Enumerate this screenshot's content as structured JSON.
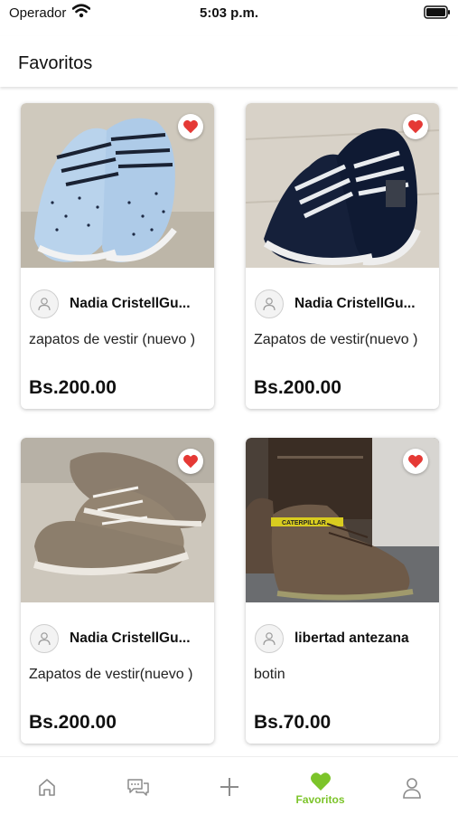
{
  "status_bar": {
    "carrier": "Operador",
    "time": "5:03 p.m."
  },
  "header": {
    "title": "Favoritos"
  },
  "products": [
    {
      "seller": "Nadia CristellGu...",
      "name": "zapatos de vestir (nuevo )",
      "price": "Bs.200.00",
      "photo": "light-blue-sneaker"
    },
    {
      "seller": "Nadia CristellGu...",
      "name": "Zapatos de vestir(nuevo )",
      "price": "Bs.200.00",
      "photo": "navy-slip-on-shoe"
    },
    {
      "seller": "Nadia CristellGu...",
      "name": "Zapatos de vestir(nuevo )",
      "price": "Bs.200.00",
      "photo": "taupe-boat-shoe"
    },
    {
      "seller": "libertad antezana",
      "name": "botin",
      "price": "Bs.70.00",
      "photo": "brown-suede-boot"
    }
  ],
  "tabbar": {
    "active_label": "Favoritos",
    "accent_color": "#7cc42a",
    "tabs": [
      "home-icon",
      "chat-icon",
      "plus-icon",
      "heart-icon",
      "profile-icon"
    ]
  },
  "colors": {
    "heart": "#e53935",
    "accent": "#7cc42a"
  }
}
